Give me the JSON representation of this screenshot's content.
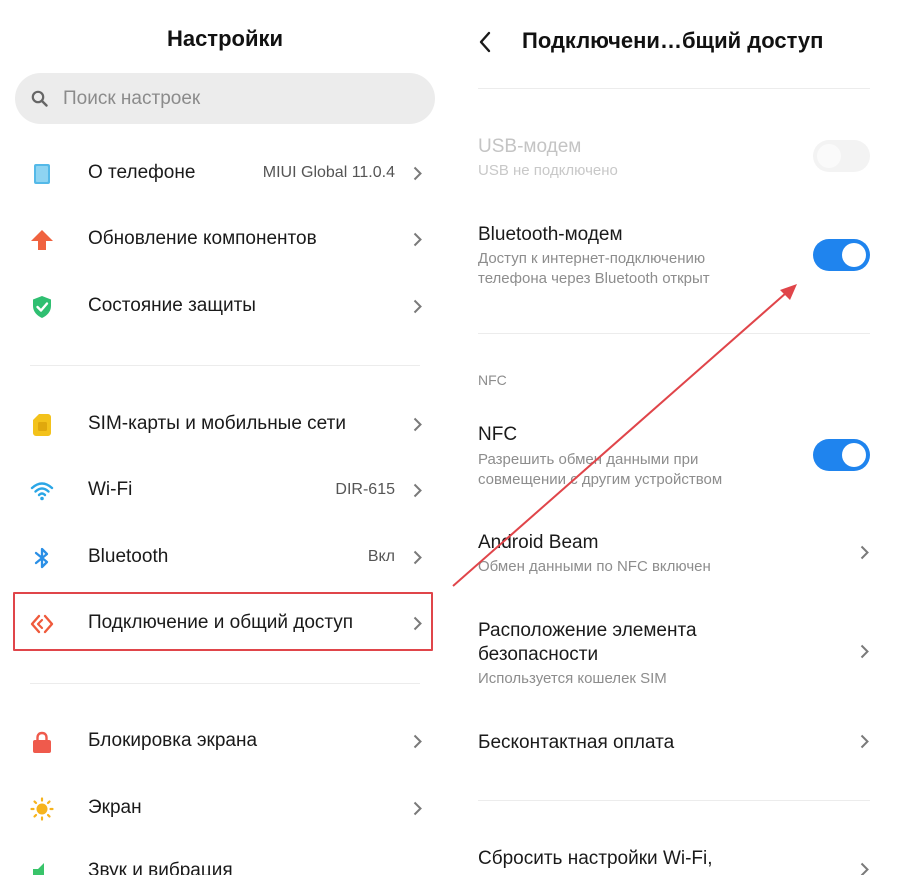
{
  "left": {
    "title": "Настройки",
    "search_placeholder": "Поиск настроек",
    "items": [
      {
        "label": "О телефоне",
        "value": "MIUI Global 11.0.4",
        "icon": "phone-icon"
      },
      {
        "label": "Обновление компонентов",
        "value": "",
        "icon": "update-arrow-icon"
      },
      {
        "label": "Состояние защиты",
        "value": "",
        "icon": "shield-check-icon"
      },
      {
        "label": "SIM-карты и мобильные сети",
        "value": "",
        "icon": "sim-card-icon"
      },
      {
        "label": "Wi-Fi",
        "value": "DIR-615",
        "icon": "wifi-icon"
      },
      {
        "label": "Bluetooth",
        "value": "Вкл",
        "icon": "bluetooth-icon"
      },
      {
        "label": "Подключение и общий доступ",
        "value": "",
        "icon": "connection-sharing-icon",
        "highlighted": true
      },
      {
        "label": "Блокировка экрана",
        "value": "",
        "icon": "lock-icon"
      },
      {
        "label": "Экран",
        "value": "",
        "icon": "brightness-icon"
      },
      {
        "label": "Звук и вибрация",
        "value": "",
        "icon": "speaker-icon"
      }
    ]
  },
  "right": {
    "title": "Подключени…бщий доступ",
    "usb": {
      "title": "USB-модем",
      "subtitle": "USB не подключено",
      "enabled": false
    },
    "bluetooth_tethering": {
      "title": "Bluetooth-модем",
      "subtitle_line1": "Доступ к интернет-подключению",
      "subtitle_line2": "телефона через Bluetooth открыт",
      "on": true
    },
    "nfc_section": "NFC",
    "nfc": {
      "title": "NFC",
      "subtitle_line1": "Разрешить обмен данными при",
      "subtitle_line2": "совмещении с другим устройством",
      "on": true
    },
    "android_beam": {
      "title": "Android Beam",
      "subtitle": "Обмен данными по NFC включен"
    },
    "secure_element": {
      "title_line1": "Расположение элемента",
      "title_line2": "безопасности",
      "subtitle": "Используется кошелек SIM"
    },
    "contactless": {
      "title": "Бесконтактная оплата"
    },
    "reset": {
      "title": "Сбросить настройки Wi-Fi,"
    }
  },
  "colors": {
    "accent_blue": "#1f84ee",
    "highlight_red": "#e0454a",
    "annotation_arrow": "#e0454a"
  }
}
